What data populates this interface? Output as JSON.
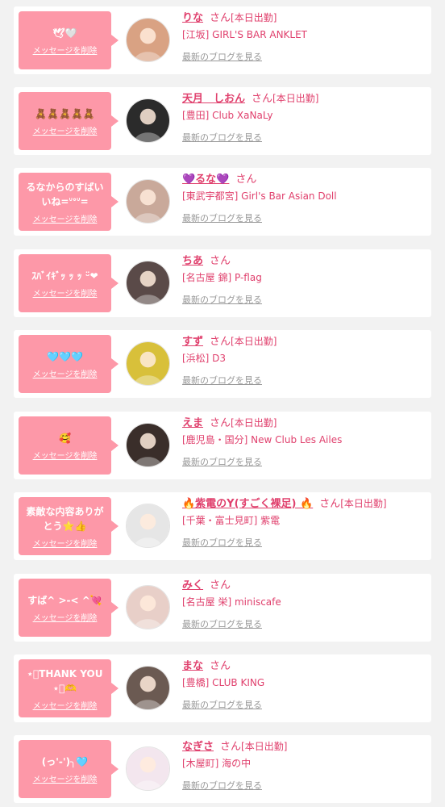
{
  "delete_label": "メッセージを削除",
  "san_label": "さん",
  "blog_label": "最新のブログを見る",
  "colors": {
    "background": "#f2f2f2",
    "bubble": "#fd98a8",
    "accent": "#e0406d",
    "muted": "#999999"
  },
  "messages": [
    {
      "message": "🕊🤍",
      "name": "りな",
      "tag": "[本日出勤]",
      "shop": "[江坂] GIRL'S BAR ANKLET",
      "avatar_bg": "#d9a283"
    },
    {
      "message": "🧸🧸🧸🧸🧸",
      "name": "天月　しおん",
      "tag": "[本日出勤]",
      "shop": "[豊田] Club XaNaLy",
      "avatar_bg": "#2b2b2b"
    },
    {
      "message": "るなからのすばいいね=ᐡᐤᐡ=",
      "name": "💜るな💜",
      "tag": "",
      "shop": "[東武宇都宮] Girl's Bar Asian Doll",
      "avatar_bg": "#c9a99a"
    },
    {
      "message": "ｽﾊﾞｲｷﾞｯ ｯ ｯ ᵕ̈❤︎",
      "name": "ちあ",
      "tag": "",
      "shop": "[名古屋 錦] P-flag",
      "avatar_bg": "#5a4a48"
    },
    {
      "message": "🩵🩵🩵",
      "name": "すず",
      "tag": "[本日出勤]",
      "shop": "[浜松] D3",
      "avatar_bg": "#d8c03a"
    },
    {
      "message": "🥰",
      "name": "えま",
      "tag": "[本日出勤]",
      "shop": "[鹿児島・国分] New Club Les Ailes",
      "avatar_bg": "#3a2e2a"
    },
    {
      "message": "素敵な内容ありがとう⭐️👍",
      "name": "🔥紫電のY(すごく裸足) 🔥",
      "tag": "[本日出勤]",
      "shop": "[千葉・富士見町] 紫電",
      "avatar_bg": "#e6e6e6"
    },
    {
      "message": "すば^ >-< ^💘",
      "name": "みく",
      "tag": "",
      "shop": "[名古屋 栄] miniscafe",
      "avatar_bg": "#e8cfc8"
    },
    {
      "message": "⋆͛THANK YOU⋆͛🫶",
      "name": "まな",
      "tag": "",
      "shop": "[豊橋] CLUB KING",
      "avatar_bg": "#6b5a52"
    },
    {
      "message": "(っ'-')╮🩵",
      "name": "なぎさ",
      "tag": "[本日出勤]",
      "shop": "[木屋町] 海の中",
      "avatar_bg": "#f3e6ee"
    }
  ]
}
